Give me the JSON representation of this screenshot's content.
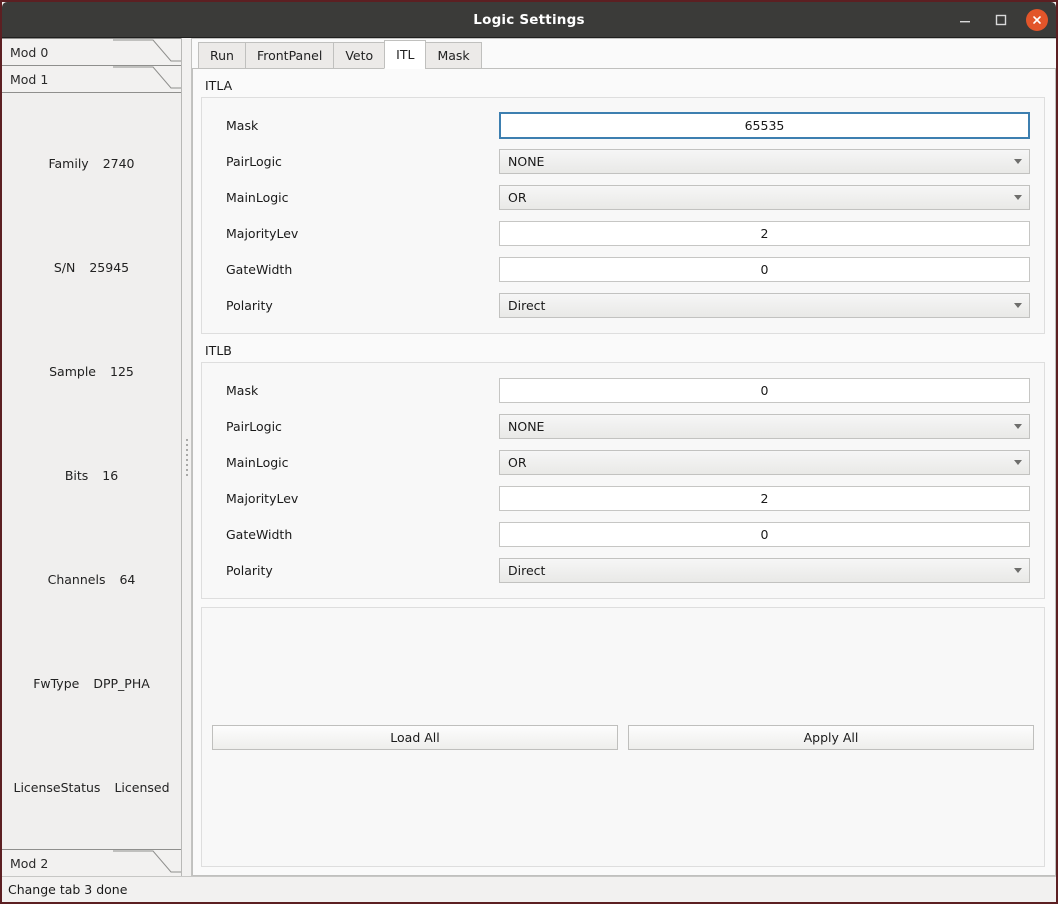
{
  "window": {
    "title": "Logic Settings",
    "controls": {
      "minimize": "minimize-icon",
      "maximize": "maximize-icon",
      "close": "close-icon"
    },
    "border_color": "#5c1f22",
    "titlebar_color": "#3b3b39",
    "close_color": "#e2552a"
  },
  "sidebar": {
    "tabs_above": [
      {
        "label": "Mod 0"
      },
      {
        "label": "Mod 1"
      }
    ],
    "tabs_below": [
      {
        "label": "Mod 2"
      }
    ],
    "selected_tab": "Mod 1",
    "properties": [
      {
        "key": "Family",
        "value": "2740"
      },
      {
        "key": "S/N",
        "value": "25945"
      },
      {
        "key": "Sample",
        "value": "125"
      },
      {
        "key": "Bits",
        "value": "16"
      },
      {
        "key": "Channels",
        "value": "64"
      },
      {
        "key": "FwType",
        "value": "DPP_PHA"
      },
      {
        "key": "LicenseStatus",
        "value": "Licensed"
      }
    ]
  },
  "splitter": {
    "grip": "splitter-grip-icon"
  },
  "main": {
    "tabs": [
      {
        "label": "Run",
        "selected": false
      },
      {
        "label": "FrontPanel",
        "selected": false
      },
      {
        "label": "Veto",
        "selected": false
      },
      {
        "label": "ITL",
        "selected": true
      },
      {
        "label": "Mask",
        "selected": false
      }
    ],
    "groups": [
      {
        "title": "ITLA",
        "fields": [
          {
            "label": "Mask",
            "type": "input",
            "value": "65535",
            "focused": true
          },
          {
            "label": "PairLogic",
            "type": "combo",
            "value": "NONE",
            "focused": false
          },
          {
            "label": "MainLogic",
            "type": "combo",
            "value": "OR",
            "focused": false
          },
          {
            "label": "MajorityLev",
            "type": "input",
            "value": "2",
            "focused": false
          },
          {
            "label": "GateWidth",
            "type": "input",
            "value": "0",
            "focused": false
          },
          {
            "label": "Polarity",
            "type": "combo",
            "value": "Direct",
            "focused": false
          }
        ]
      },
      {
        "title": "ITLB",
        "fields": [
          {
            "label": "Mask",
            "type": "input",
            "value": "0",
            "focused": false
          },
          {
            "label": "PairLogic",
            "type": "combo",
            "value": "NONE",
            "focused": false
          },
          {
            "label": "MainLogic",
            "type": "combo",
            "value": "OR",
            "focused": false
          },
          {
            "label": "MajorityLev",
            "type": "input",
            "value": "2",
            "focused": false
          },
          {
            "label": "GateWidth",
            "type": "input",
            "value": "0",
            "focused": false
          },
          {
            "label": "Polarity",
            "type": "combo",
            "value": "Direct",
            "focused": false
          }
        ]
      }
    ],
    "actions": {
      "load_all": "Load All",
      "apply_all": "Apply All"
    }
  },
  "statusbar": {
    "message": "Change tab 3 done"
  }
}
